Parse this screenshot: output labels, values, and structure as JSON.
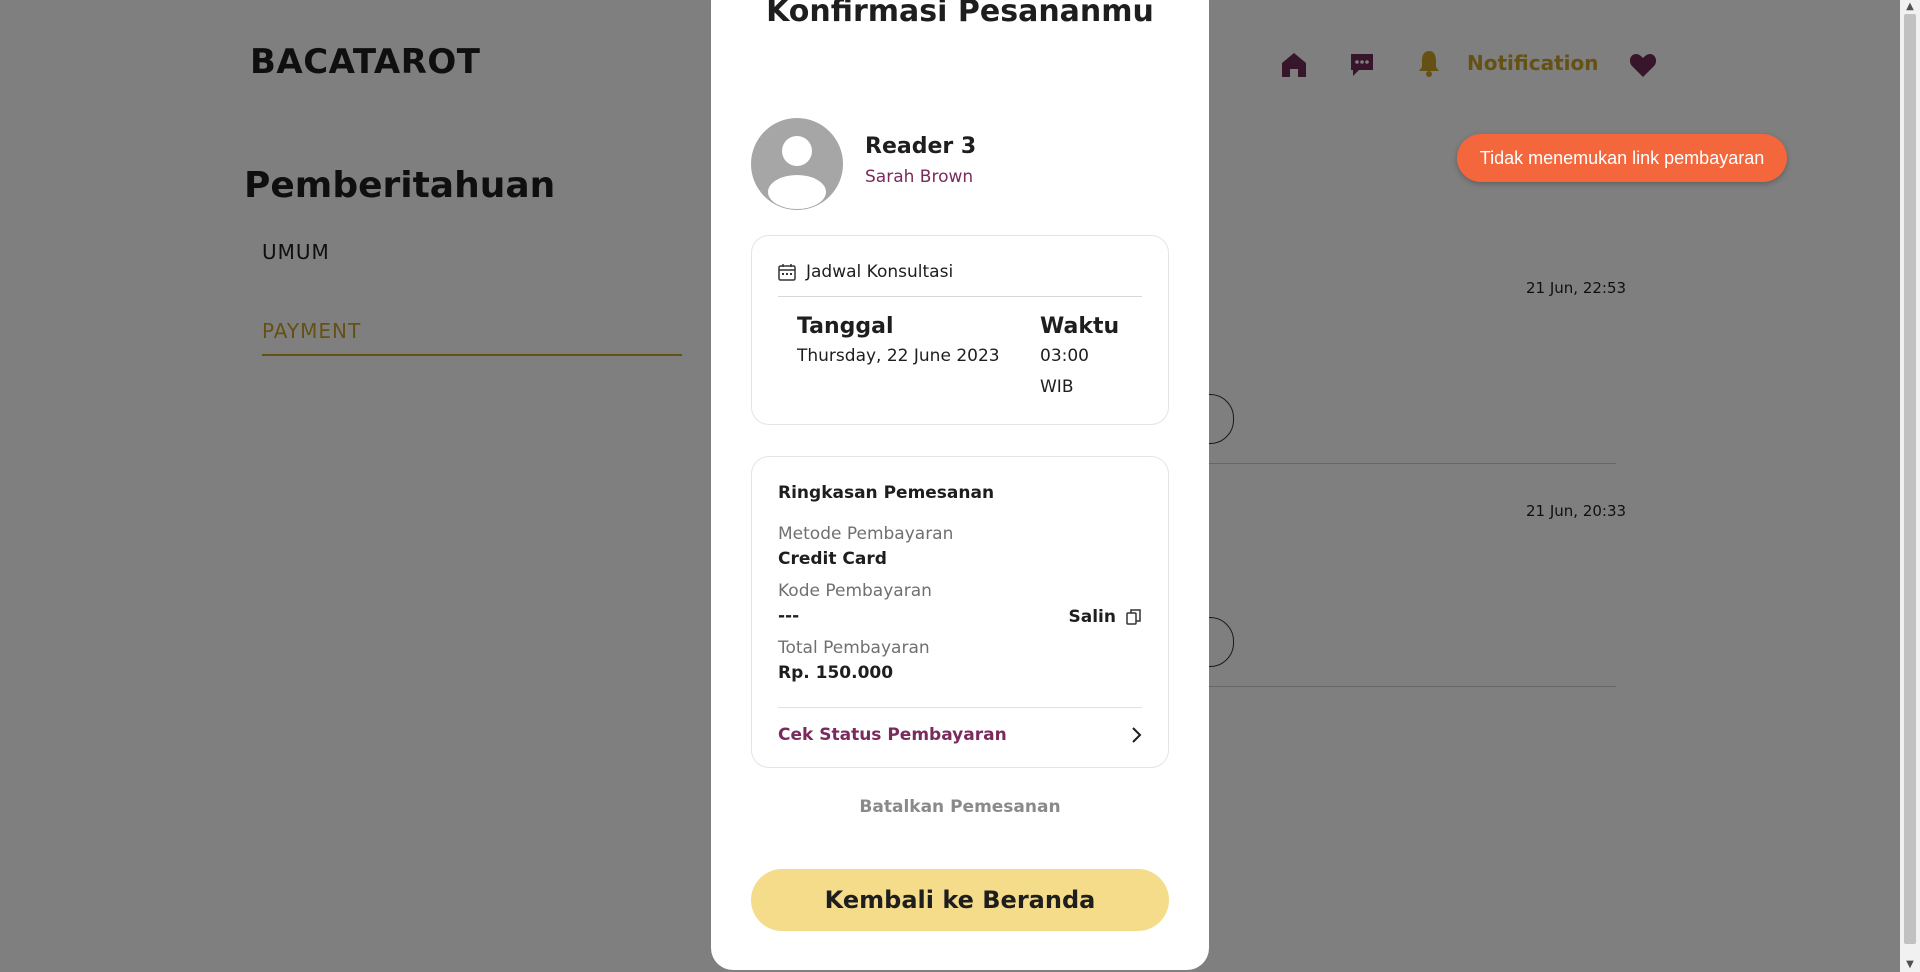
{
  "header": {
    "brand": "BACATAROT",
    "nav": {
      "notification_label": "Notification"
    }
  },
  "notifications_page": {
    "title": "Pemberitahuan",
    "tabs": [
      {
        "label": "UMUM",
        "active": false
      },
      {
        "label": "PAYMENT",
        "active": true
      }
    ],
    "items": [
      {
        "time": "21 Jun, 22:53"
      },
      {
        "time": "21 Jun, 20:33"
      }
    ]
  },
  "toast": {
    "text": "Tidak menemukan link pembayaran",
    "color": "#f4663b"
  },
  "modal": {
    "title": "Konfirmasi Pesananmu",
    "reader": {
      "name": "Reader 3",
      "subtitle": "Sarah Brown"
    },
    "schedule": {
      "heading": "Jadwal Konsultasi",
      "date_label": "Tanggal",
      "date_value": "Thursday, 22 June 2023",
      "time_label": "Waktu",
      "time_value": "03:00",
      "time_zone": "WIB"
    },
    "summary": {
      "heading": "Ringkasan Pemesanan",
      "method_label": "Metode Pembayaran",
      "method_value": "Credit Card",
      "code_label": "Kode Pembayaran",
      "code_value": "---",
      "copy_label": "Salin",
      "total_label": "Total Pembayaran",
      "total_value": "Rp. 150.000",
      "check_status_label": "Cek Status Pembayaran"
    },
    "cancel_label": "Batalkan Pemesanan",
    "home_button_label": "Kembali ke Beranda"
  },
  "colors": {
    "accent_gold": "#c9a227",
    "accent_plum": "#7a2b5c",
    "button_yellow": "#f5dc8b",
    "overlay": "rgba(0,0,0,0.5)"
  },
  "icons": [
    "home-icon",
    "chat-icon",
    "bell-icon",
    "heart-icon",
    "calendar-icon",
    "copy-icon",
    "chevron-right-icon",
    "user-avatar-icon"
  ]
}
